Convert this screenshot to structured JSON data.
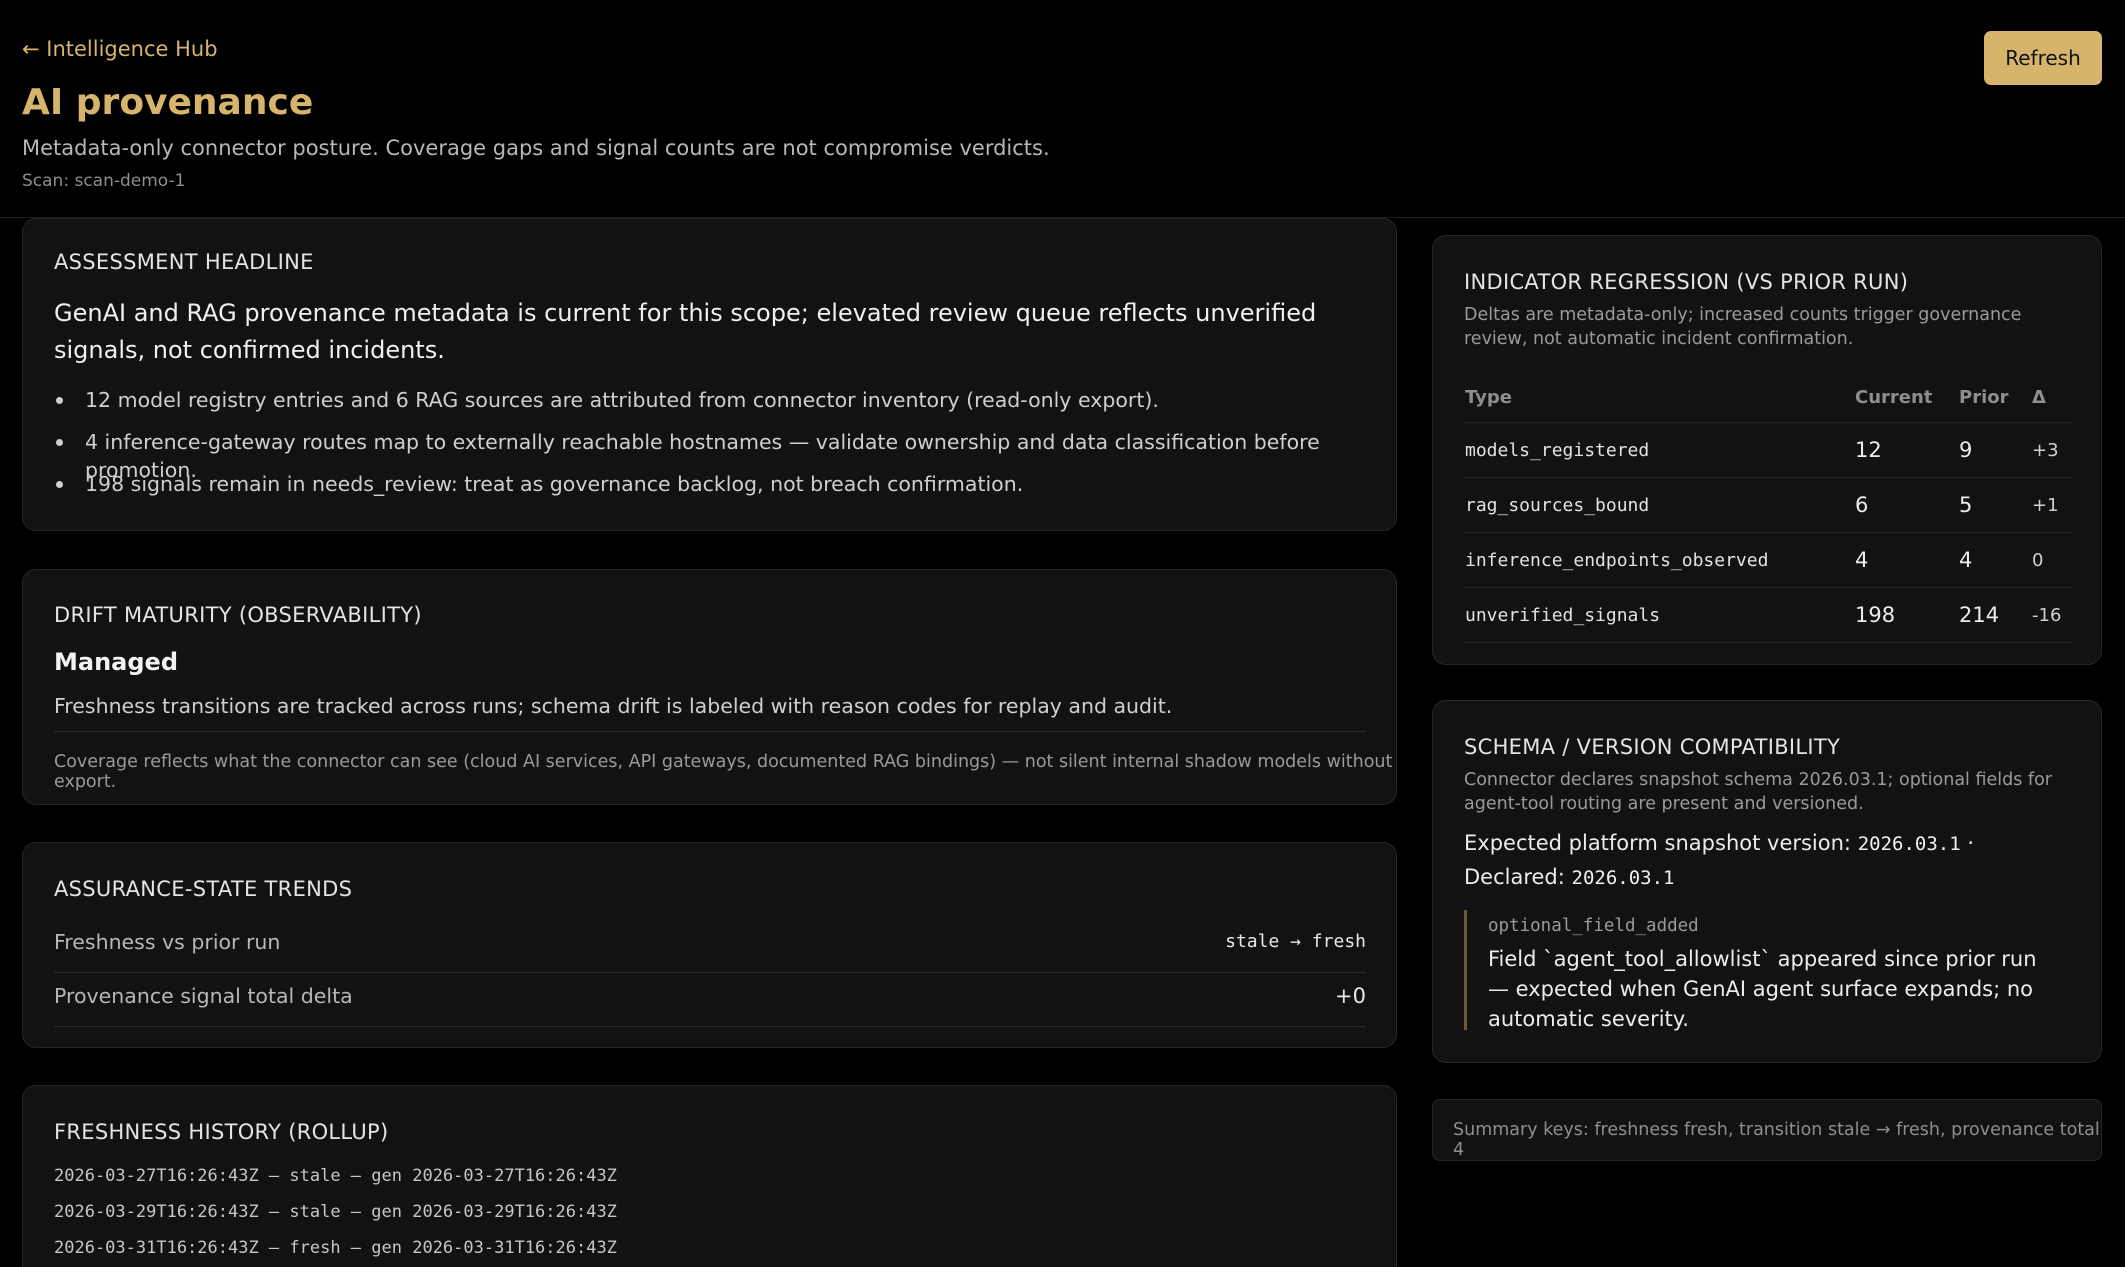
{
  "header": {
    "back_label": "← Intelligence Hub",
    "title": "AI provenance",
    "subtitle": "Metadata-only connector posture. Coverage gaps and signal counts are not compromise verdicts.",
    "scan": "Scan: scan-demo-1",
    "refresh_label": "Refresh"
  },
  "assessment": {
    "title": "Assessment headline",
    "headline": "GenAI and RAG provenance metadata is current for this scope; elevated review queue reflects unverified signals, not confirmed incidents.",
    "bullets": [
      "12 model registry entries and 6 RAG sources are attributed from connector inventory (read-only export).",
      "4 inference-gateway routes map to externally reachable hostnames — validate ownership and data classification before promotion.",
      "198 signals remain in needs_review: treat as governance backlog, not breach confirmation."
    ]
  },
  "drift": {
    "title": "Drift maturity (observability)",
    "level": "Managed",
    "description": "Freshness transitions are tracked across runs; schema drift is labeled with reason codes for replay and audit.",
    "note": "Coverage reflects what the connector can see (cloud AI services, API gateways, documented RAG bindings) — not silent internal shadow models without export."
  },
  "trends": {
    "title": "Assurance-state trends",
    "rows": [
      {
        "label": "Freshness vs prior run",
        "value": "stale → fresh"
      },
      {
        "label": "Provenance signal total delta",
        "value": "+0"
      }
    ]
  },
  "history": {
    "title": "Freshness history (rollup)",
    "lines": [
      "2026-03-27T16:26:43Z — stale — gen 2026-03-27T16:26:43Z",
      "2026-03-29T16:26:43Z — stale — gen 2026-03-29T16:26:43Z",
      "2026-03-31T16:26:43Z — fresh — gen 2026-03-31T16:26:43Z"
    ]
  },
  "regression": {
    "title": "Indicator regression (vs prior run)",
    "subtitle": "Deltas are metadata-only; increased counts trigger governance review, not automatic incident confirmation.",
    "columns": [
      "Type",
      "Current",
      "Prior",
      "Δ"
    ],
    "rows": [
      {
        "type": "models_registered",
        "current": "12",
        "prior": "9",
        "delta": "+3"
      },
      {
        "type": "rag_sources_bound",
        "current": "6",
        "prior": "5",
        "delta": "+1"
      },
      {
        "type": "inference_endpoints_observed",
        "current": "4",
        "prior": "4",
        "delta": "0"
      },
      {
        "type": "unverified_signals",
        "current": "198",
        "prior": "214",
        "delta": "-16"
      }
    ]
  },
  "schema": {
    "title": "Schema / version compatibility",
    "subtitle": "Connector declares snapshot schema 2026.03.1; optional fields for agent-tool routing are present and versioned.",
    "expected_label": "Expected platform snapshot version:",
    "expected_version": "2026.03.1",
    "declared_label": "· Declared:",
    "declared_version": "2026.03.1",
    "change_code": "optional_field_added",
    "change_text": "Field `agent_tool_allowlist` appeared since prior run — expected when GenAI agent surface expands; no automatic severity."
  },
  "summary": {
    "text": "Summary keys: freshness fresh, transition stale → fresh, provenance total 4"
  }
}
